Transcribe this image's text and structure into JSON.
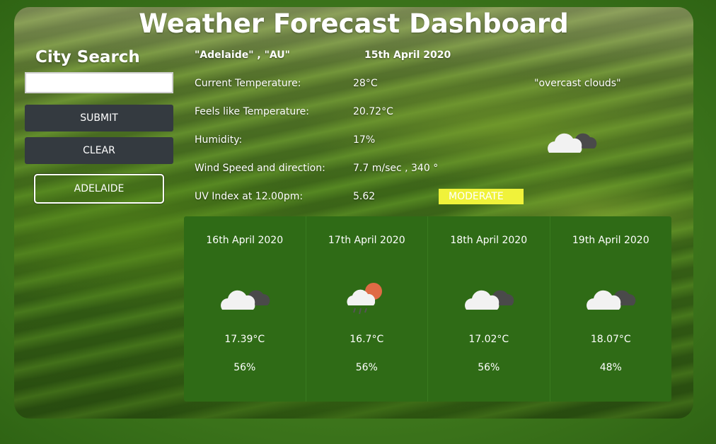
{
  "header": {
    "title": "Weather Forecast Dashboard"
  },
  "sidebar": {
    "title": "City Search",
    "search": {
      "value": "",
      "placeholder": ""
    },
    "submit_label": "SUBMIT",
    "clear_label": "CLEAR",
    "history": [
      "ADELAIDE"
    ]
  },
  "current": {
    "location": "\"Adelaide\" , \"AU\"",
    "date": "15th April 2020",
    "description": "\"overcast clouds\"",
    "icon": "overcast-clouds-icon",
    "rows": [
      {
        "label": "Current Temperature:",
        "value": "28°C"
      },
      {
        "label": "Feels like Temperature:",
        "value": "20.72°C"
      },
      {
        "label": "Humidity:",
        "value": "17%"
      },
      {
        "label": "Wind Speed and direction:",
        "value": "7.7 m/sec , 340 °"
      },
      {
        "label": "UV Index at 12.00pm:",
        "value": "5.62"
      }
    ],
    "uv_badge": "MODERATE",
    "uv_badge_color": "#f0f23a"
  },
  "forecast": [
    {
      "date": "16th April 2020",
      "icon": "overcast-clouds-icon",
      "temp": "17.39°C",
      "humidity": "56%"
    },
    {
      "date": "17th April 2020",
      "icon": "sun-cloud-rain-icon",
      "temp": "16.7°C",
      "humidity": "56%"
    },
    {
      "date": "18th April 2020",
      "icon": "overcast-clouds-icon",
      "temp": "17.02°C",
      "humidity": "56%"
    },
    {
      "date": "19th April 2020",
      "icon": "overcast-clouds-icon",
      "temp": "18.07°C",
      "humidity": "48%"
    }
  ],
  "colors": {
    "button_bg": "#343a40",
    "forecast_bg": "#2f6b16",
    "accent": "#f0f23a"
  }
}
